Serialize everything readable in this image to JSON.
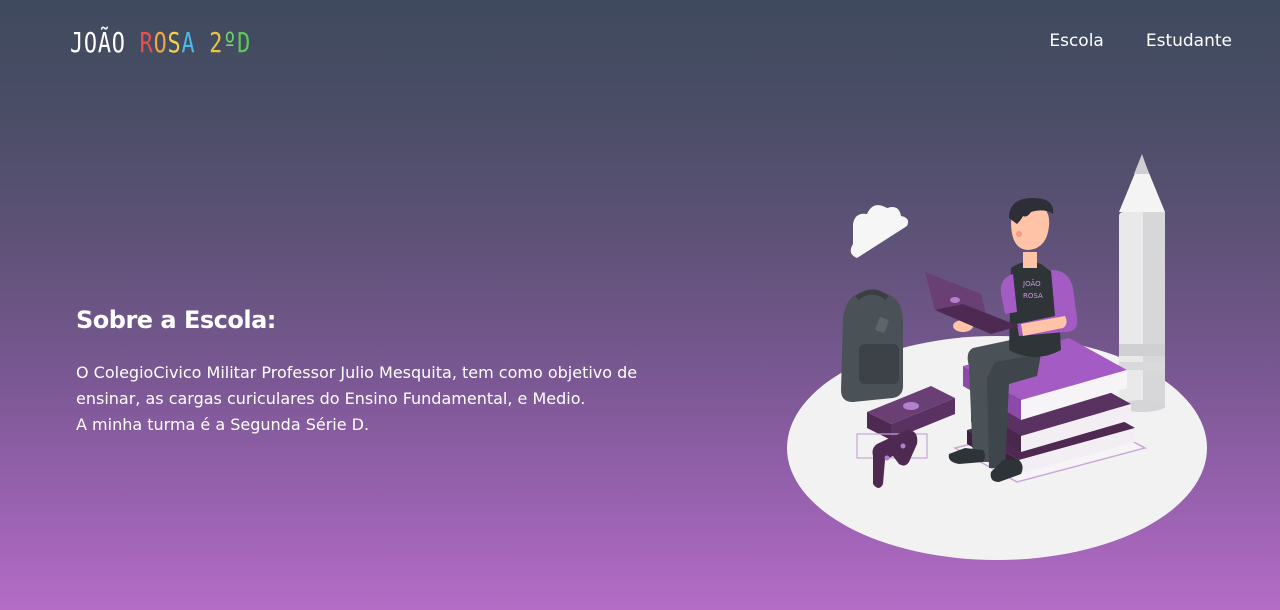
{
  "navbar": {
    "logo": {
      "letters": [
        {
          "char": "J",
          "color": "#ffffff"
        },
        {
          "char": "O",
          "color": "#ffffff"
        },
        {
          "char": "Ã",
          "color": "#ffffff"
        },
        {
          "char": "O",
          "color": "#ffffff"
        },
        {
          "char": " ",
          "color": "#ffffff"
        },
        {
          "char": "R",
          "color": "#e8504a"
        },
        {
          "char": "O",
          "color": "#f2a640"
        },
        {
          "char": "S",
          "color": "#f2d24a"
        },
        {
          "char": "A",
          "color": "#4bb9e8"
        },
        {
          "char": " ",
          "color": "#ffffff"
        },
        {
          "char": "2",
          "color": "#e8c640"
        },
        {
          "char": "º",
          "color": "#6fd66a"
        },
        {
          "char": "D",
          "color": "#5cc95a"
        }
      ]
    },
    "links": [
      "Escola",
      "Estudante"
    ]
  },
  "main": {
    "heading": "Sobre a Escola:",
    "paragraph_lines": [
      "O ColegioCivico Militar Professor Julio Mesquita, tem como objetivo de",
      "ensinar, as cargas curiculares do Ensino Fundamental, e Medio.",
      "A minha turma é a Segunda Série D."
    ]
  },
  "illustration": {
    "shirt_text_line1": "JOÃO",
    "shirt_text_line2": "ROSA",
    "accent_color": "#a45bc4",
    "dark_purple": "#4e2a52"
  }
}
